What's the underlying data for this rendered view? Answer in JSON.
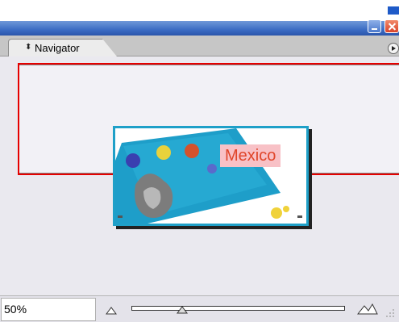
{
  "panel": {
    "title": "Navigator",
    "tab_arrows_glyph": "⬍",
    "menu_icon": "panel-menu-icon"
  },
  "window_controls": {
    "minimize_icon": "minimize-icon",
    "close_icon": "close-icon"
  },
  "thumbnail": {
    "caption": "Mexico"
  },
  "zoom": {
    "value": "50%",
    "slider_level": 0.25,
    "zoom_out_icon": "zoom-out-mountain-icon",
    "zoom_in_icon": "zoom-in-mountain-icon"
  },
  "colors": {
    "view_box": "#e60000",
    "title_bar": "#3b6cc4",
    "close_button": "#d9442a",
    "thumbnail_border": "#1fa0c8",
    "caption_text": "#e0452a"
  }
}
